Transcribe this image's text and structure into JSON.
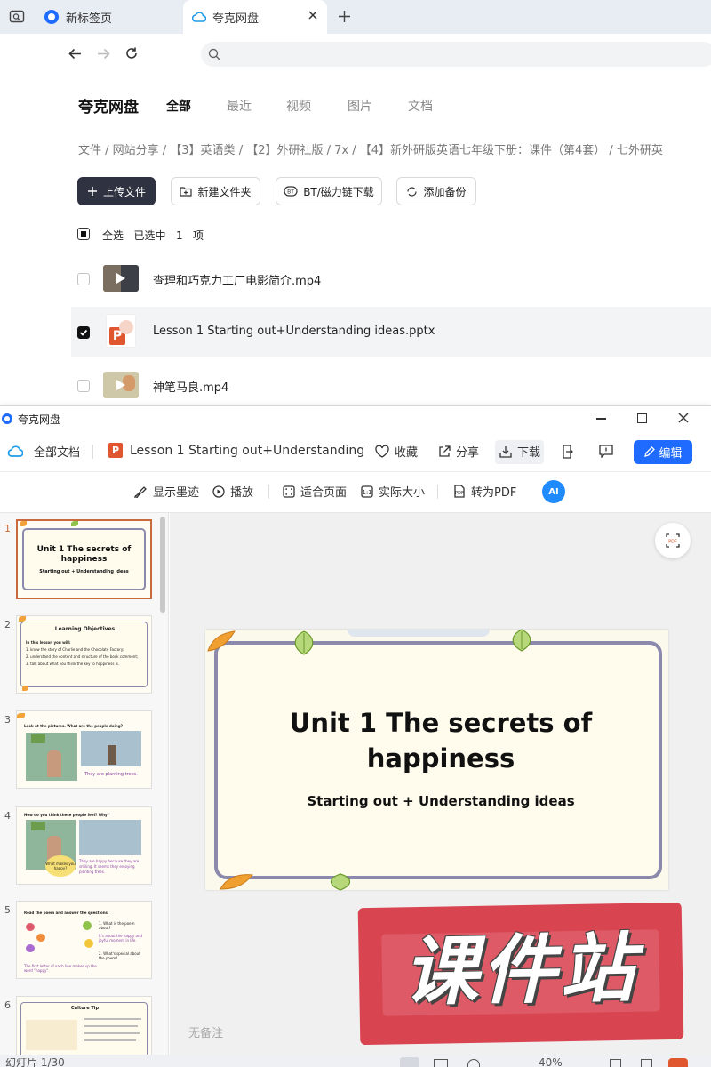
{
  "browser": {
    "tabs": [
      {
        "label": "新标签页"
      },
      {
        "label": "夸克网盘"
      }
    ]
  },
  "page": {
    "app_title": "夸克网盘",
    "nav": [
      "全部",
      "最近",
      "视频",
      "图片",
      "文档"
    ],
    "breadcrumb": "文件 / 网站分享 / 【3】英语类 / 【2】外研社版 / 7x / 【4】新外研版英语七年级下册：课件（第4套） / 七外研英",
    "actions": {
      "upload": "上传文件",
      "new_folder": "新建文件夹",
      "bt": "BT/磁力链下载",
      "backup": "添加备份"
    },
    "selection": {
      "select_all": "全选",
      "selected": "已选中",
      "count": "1",
      "unit": "项"
    },
    "files": [
      {
        "name": "查理和巧克力工厂电影简介.mp4",
        "checked": false
      },
      {
        "name": "Lesson 1 Starting out+Understanding ideas.pptx",
        "checked": true
      },
      {
        "name": "神笔马良.mp4",
        "checked": false
      }
    ]
  },
  "viewer": {
    "window_title": "夸克网盘",
    "toolbar": {
      "all_docs": "全部文档",
      "doc_name": "Lesson 1 Starting out+Understanding",
      "favorite": "收藏",
      "share": "分享",
      "download": "下载",
      "edit": "编辑"
    },
    "subtoolbar": {
      "ink": "显示墨迹",
      "play": "播放",
      "fit": "适合页面",
      "actual": "实际大小",
      "to_pdf": "转为PDF",
      "ai": "AI"
    },
    "thumbnails": [
      {
        "num": "1",
        "title": "Unit 1  The secrets of happiness",
        "sub": "Starting out + Understanding ideas"
      },
      {
        "num": "2",
        "title": "Learning Objectives",
        "line0": "In this lesson you will:",
        "line1": "1. know the story of Charlie and the Chocolate Factory;",
        "line2": "2. understand the content and structure of the book comment;",
        "line3": "3. talk about what you think the key to happiness is."
      },
      {
        "num": "3",
        "title": "Look at the pictures. What are the people doing?",
        "caption": "They are planting trees."
      },
      {
        "num": "4",
        "title": "How do you think these people feel? Why?",
        "bubble": "What makes you happy?",
        "caption": "They are happy because they are smiling. It seems they enjoying planting trees."
      },
      {
        "num": "5",
        "title": "Read the poem and answer the questions.",
        "q1": "1. What is the poem about?",
        "q2": "2. What's special about the poem?",
        "note": "It's about the happy and joyful moment in life.",
        "caption": "The first letter of each line makes up the word \"happy\"."
      },
      {
        "num": "6",
        "title": "Culture Tip"
      }
    ],
    "slide": {
      "title_line1": "Unit 1  The secrets of",
      "title_line2": "happiness",
      "subtitle": "Starting out + Understanding ideas"
    },
    "watermark": "课件站",
    "notes": "无备注",
    "status": {
      "slide_count": "幻灯片 1/30",
      "zoom": "40%"
    }
  },
  "colors": {
    "accent": "#1f6bff",
    "brand_dark": "#2e3241",
    "thumb_selected": "#c86a3d",
    "slide_frame": "#8c8aac",
    "watermark": "#d94451"
  }
}
